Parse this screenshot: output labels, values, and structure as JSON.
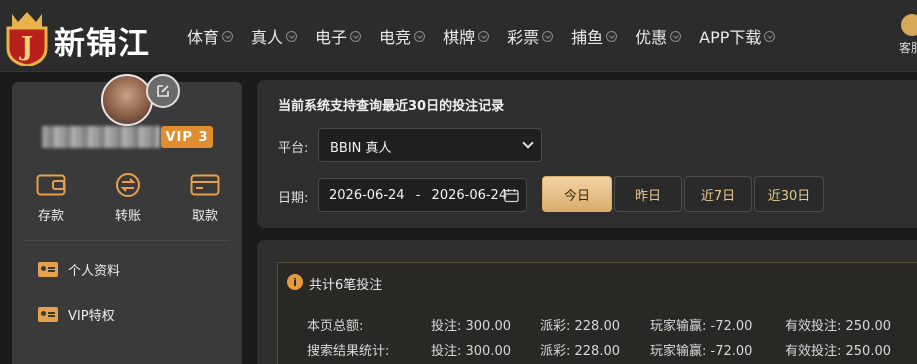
{
  "brand": {
    "name": "新锦江",
    "badge_letter": "J"
  },
  "nav": {
    "items": [
      "体育",
      "真人",
      "电子",
      "电竞",
      "棋牌",
      "彩票",
      "捕鱼",
      "优惠",
      "APP下载"
    ],
    "service_label": "客服"
  },
  "profile": {
    "vip_level": "VIP 3"
  },
  "quick_actions": [
    "存款",
    "转账",
    "取款"
  ],
  "menu": [
    "个人资料",
    "VIP特权"
  ],
  "filter": {
    "title": "当前系统支持查询最近30日的投注记录",
    "platform_label": "平台:",
    "platform_value": "BBIN 真人",
    "date_label": "日期:",
    "date_start": "2026-06-24",
    "date_separator": "-",
    "date_end": "2026-06-24",
    "quick_ranges": [
      "今日",
      "昨日",
      "近7日",
      "近30日"
    ],
    "active_range": "今日"
  },
  "summary": {
    "count_text": "共计6笔投注",
    "rows": [
      {
        "label": "本页总额:",
        "bet": "投注: 300.00",
        "payout": "派彩: 228.00",
        "winloss": "玩家输赢: -72.00",
        "valid": "有效投注: 250.00"
      },
      {
        "label": "搜索结果统计:",
        "bet": "投注: 300.00",
        "payout": "派彩: 228.00",
        "winloss": "玩家输赢: -72.00",
        "valid": "有效投注: 250.00"
      }
    ]
  },
  "colors": {
    "accent": "#e08e2f",
    "gold": "#d9ad6e",
    "panel": "#2e2e2f"
  }
}
